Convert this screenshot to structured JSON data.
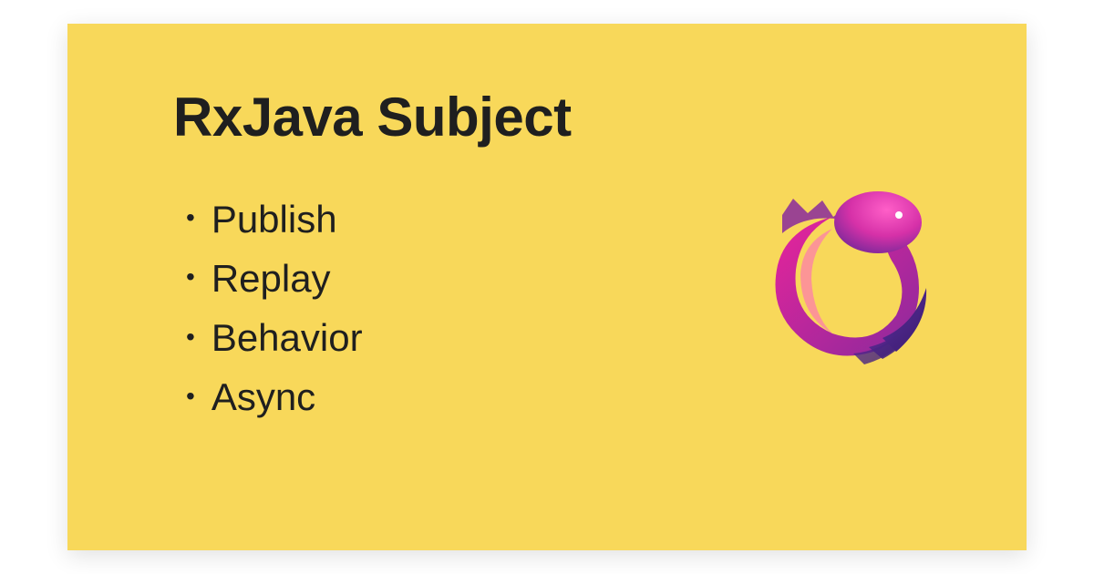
{
  "title": "RxJava Subject",
  "items": [
    "Publish",
    "Replay",
    "Behavior",
    "Async"
  ],
  "logo_name": "reactivex-logo",
  "colors": {
    "background": "#f8d85a",
    "text": "#1f1f1f",
    "logo_pink": "#e8249b",
    "logo_purple": "#5a2b9d"
  }
}
